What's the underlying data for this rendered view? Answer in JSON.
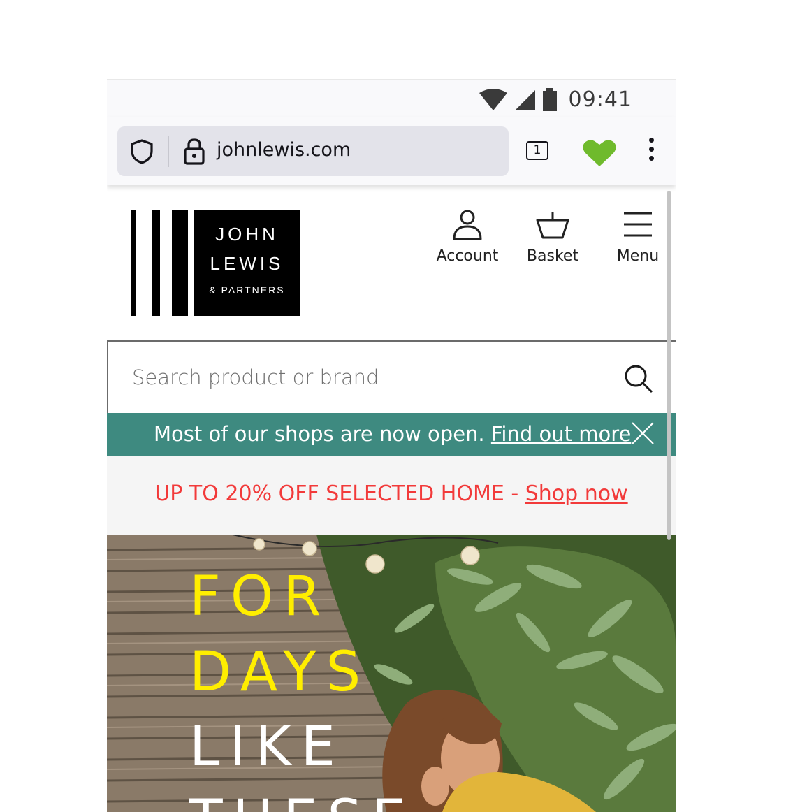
{
  "status_bar": {
    "time": "09:41",
    "icons": [
      "wifi-icon",
      "cell-signal-icon",
      "battery-icon"
    ]
  },
  "browser": {
    "url": "johnlewis.com",
    "tab_count": "1",
    "icons": [
      "shield-icon",
      "lock-icon",
      "tabs-icon",
      "heart-icon",
      "kebab-menu-icon"
    ]
  },
  "logo": {
    "line1": "JOHN",
    "line2": "LEWIS",
    "line3": "& PARTNERS"
  },
  "nav": {
    "account": "Account",
    "basket": "Basket",
    "menu": "Menu"
  },
  "search": {
    "placeholder": "Search product or brand"
  },
  "notice": {
    "text": "Most of our shops are now open.",
    "link": "Find out more",
    "color": "#3e8a80"
  },
  "promo": {
    "text": "UP TO 20% OFF SELECTED HOME - ",
    "link": "Shop now",
    "color": "#f23a3a"
  },
  "hero": {
    "lines": [
      "FOR",
      "DAYS",
      "LIKE",
      "THESE"
    ],
    "colors": [
      "#ffee00",
      "#ffee00",
      "#ffffff",
      "#ffffff"
    ]
  }
}
